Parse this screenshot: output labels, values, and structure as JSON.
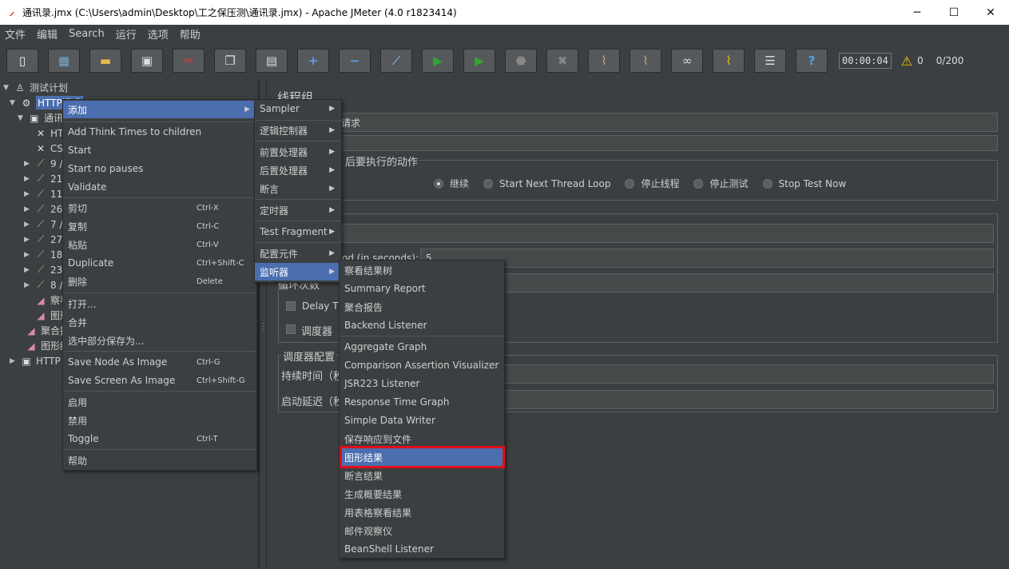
{
  "window": {
    "title": "通讯录.jmx (C:\\Users\\admin\\Desktop\\工之保压测\\通讯录.jmx) - Apache JMeter (4.0 r1823414)",
    "minimize": "─",
    "maximize": "☐",
    "close": "✕"
  },
  "menubar": [
    "文件",
    "编辑",
    "Search",
    "运行",
    "选项",
    "帮助"
  ],
  "toolbar": {
    "timer": "00:00:04",
    "warn_count": "0",
    "threads": "0/200"
  },
  "tree": {
    "root": "测试计划",
    "thread_group": "HTTP请求",
    "controller": "通讯",
    "items": [
      "HT",
      "CS",
      "9 /",
      "21",
      "11",
      "26",
      "7 /",
      "27",
      "18",
      "23",
      "8 /",
      "察看",
      "图形",
      "聚合报",
      "图形结",
      "HTTP"
    ]
  },
  "right": {
    "heading": "线程组",
    "name_value": "请求",
    "action_label": "后要执行的动作",
    "radios": [
      "继续",
      "Start Next Thread Loop",
      "停止线程",
      "停止测试",
      "Stop Test Now"
    ],
    "rampup_label": "od (in seconds):",
    "rampup_value": "5",
    "loop_label": "循环次数",
    "delay_label": "Delay Th",
    "scheduler_label": "调度器",
    "scheduler_config": "调度器配置",
    "duration_label": "持续时间（秒",
    "startup_delay_label": "启动延迟（秒"
  },
  "context_menu": {
    "add": "添加",
    "add_think_times": "Add Think Times to children",
    "start": "Start",
    "start_no_pauses": "Start no pauses",
    "validate": "Validate",
    "cut": "剪切",
    "cut_sc": "Ctrl-X",
    "copy": "复制",
    "copy_sc": "Ctrl-C",
    "paste": "粘贴",
    "paste_sc": "Ctrl-V",
    "duplicate": "Duplicate",
    "duplicate_sc": "Ctrl+Shift-C",
    "delete": "删除",
    "delete_sc": "Delete",
    "open": "打开...",
    "merge": "合并",
    "save_selection": "选中部分保存为...",
    "save_node_image": "Save Node As Image",
    "save_node_image_sc": "Ctrl-G",
    "save_screen_image": "Save Screen As Image",
    "save_screen_image_sc": "Ctrl+Shift-G",
    "enable": "启用",
    "disable": "禁用",
    "toggle": "Toggle",
    "toggle_sc": "Ctrl-T",
    "help": "帮助"
  },
  "add_menu": {
    "sampler": "Sampler",
    "logic_controller": "逻辑控制器",
    "pre_processor": "前置处理器",
    "post_processor": "后置处理器",
    "assertion": "断言",
    "timer": "定时器",
    "test_fragment": "Test Fragment",
    "config_element": "配置元件",
    "listener": "监听器"
  },
  "listener_menu": [
    "察看结果树",
    "Summary Report",
    "聚合报告",
    "Backend Listener",
    "Aggregate Graph",
    "Comparison Assertion Visualizer",
    "JSR223 Listener",
    "Response Time Graph",
    "Simple Data Writer",
    "保存响应到文件",
    "图形结果",
    "断言结果",
    "生成概要结果",
    "用表格察看结果",
    "邮件观察仪",
    "BeanShell Listener"
  ],
  "colors": {
    "highlight": "#4b6eaf",
    "callout": "#e0101a",
    "background": "#3c3f41"
  }
}
